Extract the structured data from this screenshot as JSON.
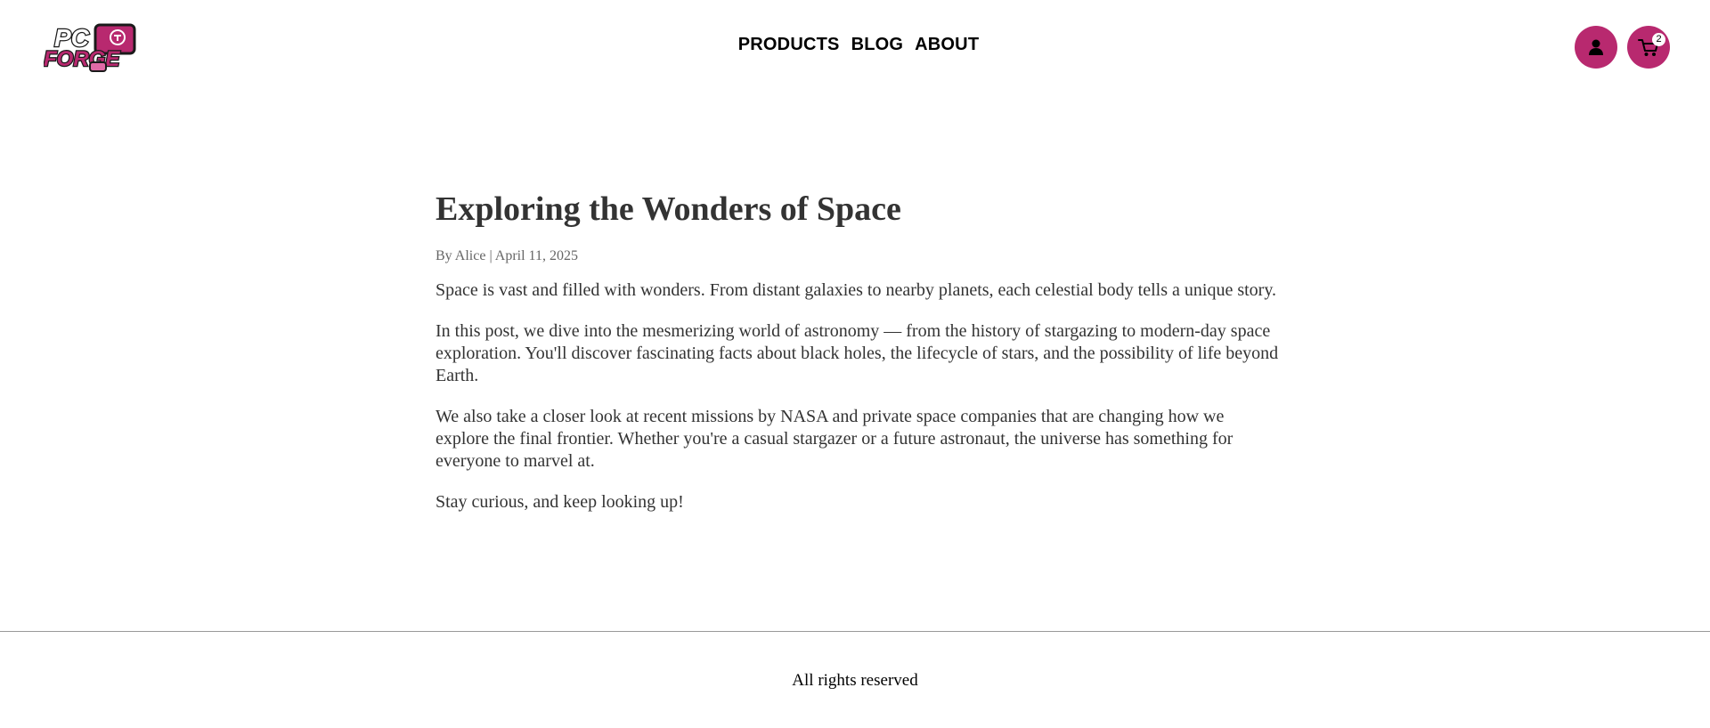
{
  "header": {
    "logo_text": "PC FORGE",
    "nav": [
      {
        "label": "PRODUCTS"
      },
      {
        "label": "BLOG"
      },
      {
        "label": "ABOUT"
      }
    ],
    "cart_count": "2",
    "accent_color": "#b8296f"
  },
  "article": {
    "title": "Exploring the Wonders of Space",
    "meta": "By Alice | April 11, 2025",
    "paragraphs": [
      "Space is vast and filled with wonders. From distant galaxies to nearby planets, each celestial body tells a unique story.",
      "In this post, we dive into the mesmerizing world of astronomy — from the history of stargazing to modern-day space exploration. You'll discover fascinating facts about black holes, the lifecycle of stars, and the possibility of life beyond Earth.",
      "We also take a closer look at recent missions by NASA and private space companies that are changing how we explore the final frontier. Whether you're a casual stargazer or a future astronaut, the universe has something for everyone to marvel at.",
      "Stay curious, and keep looking up!"
    ]
  },
  "footer": {
    "text": "All rights reserved"
  },
  "icons": {
    "account": "user-icon",
    "cart": "cart-icon"
  }
}
